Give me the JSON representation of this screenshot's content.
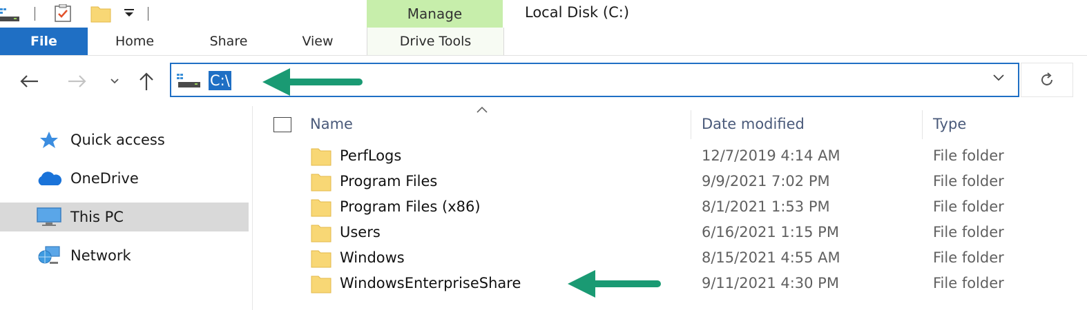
{
  "title_bar": {
    "manage_tab_label": "Manage",
    "window_title": "Local Disk (C:)"
  },
  "ribbon": {
    "tabs": [
      {
        "label": "File"
      },
      {
        "label": "Home"
      },
      {
        "label": "Share"
      },
      {
        "label": "View"
      },
      {
        "label": "Drive Tools"
      }
    ]
  },
  "address_bar": {
    "path": "C:\\"
  },
  "sidebar": {
    "items": [
      {
        "label": "Quick access",
        "icon": "star-icon"
      },
      {
        "label": "OneDrive",
        "icon": "cloud-icon"
      },
      {
        "label": "This PC",
        "icon": "computer-icon",
        "selected": true
      },
      {
        "label": "Network",
        "icon": "network-icon"
      }
    ]
  },
  "file_list": {
    "columns": [
      "Name",
      "Date modified",
      "Type"
    ],
    "rows": [
      {
        "name": "PerfLogs",
        "date": "12/7/2019 4:14 AM",
        "type": "File folder"
      },
      {
        "name": "Program Files",
        "date": "9/9/2021 7:02 PM",
        "type": "File folder"
      },
      {
        "name": "Program Files (x86)",
        "date": "8/1/2021 1:53 PM",
        "type": "File folder"
      },
      {
        "name": "Users",
        "date": "6/16/2021 1:15 PM",
        "type": "File folder"
      },
      {
        "name": "Windows",
        "date": "8/15/2021 4:55 AM",
        "type": "File folder"
      },
      {
        "name": "WindowsEnterpriseShare",
        "date": "9/11/2021 4:30 PM",
        "type": "File folder"
      }
    ]
  },
  "colors": {
    "accent": "#1f6fc4",
    "manage_tab": "#c7eeab",
    "annotation_arrow": "#1a9a73",
    "folder": "#f8d775"
  }
}
